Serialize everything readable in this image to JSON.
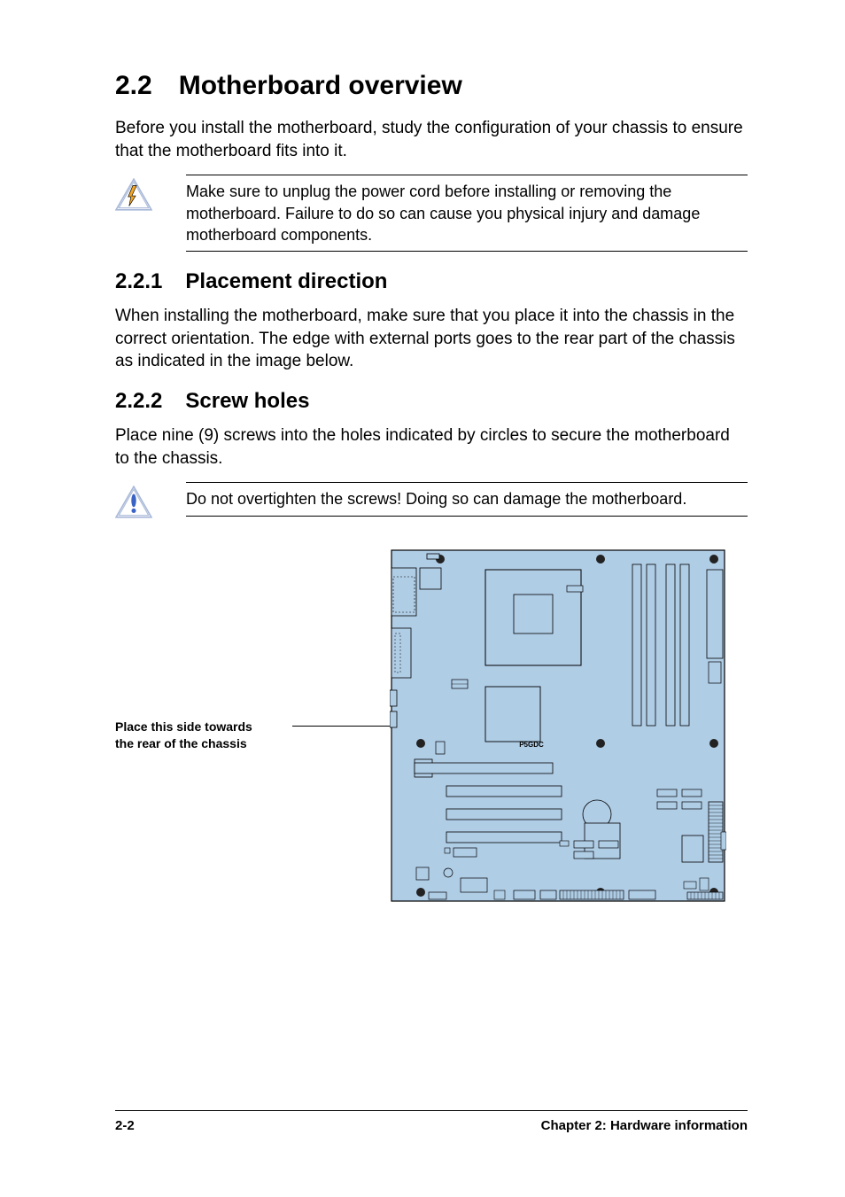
{
  "section": {
    "number": "2.2",
    "title": "Motherboard overview",
    "intro": "Before you install the motherboard, study the configuration of your chassis to ensure that the motherboard fits into it."
  },
  "warning1": {
    "text": "Make sure to unplug the power cord before installing or removing the motherboard. Failure to do so can cause you physical injury and damage motherboard components."
  },
  "sub1": {
    "number": "2.2.1",
    "title": "Placement direction",
    "body": "When installing the motherboard, make sure that you place it into the chassis in the correct orientation. The edge with external ports goes to the rear part of the chassis as indicated in the image below."
  },
  "sub2": {
    "number": "2.2.2",
    "title": "Screw holes",
    "body": "Place nine (9) screws into the holes indicated by circles to secure the motherboard to the chassis."
  },
  "caution1": {
    "text": "Do not overtighten the screws! Doing so can damage the motherboard."
  },
  "figure": {
    "callout_line1": "Place this side towards",
    "callout_line2": "the rear of the chassis",
    "board_label": "P5GDC"
  },
  "footer": {
    "page": "2-2",
    "chapter": "Chapter 2: Hardware information"
  }
}
